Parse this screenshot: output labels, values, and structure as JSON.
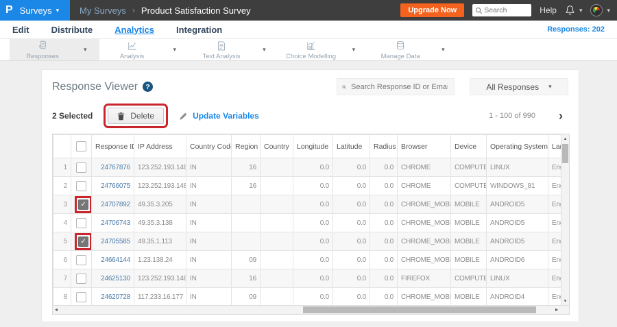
{
  "topbar": {
    "logo_letter": "P",
    "product_menu_label": "Surveys",
    "breadcrumb": {
      "parent": "My Surveys",
      "separator": "›",
      "current": "Product Satisfaction Survey"
    },
    "upgrade_button_label": "Upgrade Now",
    "search_placeholder": "Search",
    "help_label": "Help"
  },
  "nav": {
    "items": [
      {
        "label": "Edit",
        "active": false
      },
      {
        "label": "Distribute",
        "active": false
      },
      {
        "label": "Analytics",
        "active": true
      },
      {
        "label": "Integration",
        "active": false
      }
    ],
    "responses_count": "Responses: 202"
  },
  "toolbar": {
    "items": [
      {
        "label": "Responses",
        "icon": "responses-icon",
        "active": true
      },
      {
        "label": "Analysis",
        "icon": "analysis-icon",
        "active": false
      },
      {
        "label": "Text Analysis",
        "icon": "text-analysis-icon",
        "active": false
      },
      {
        "label": "Choice Modelling",
        "icon": "choice-modelling-icon",
        "active": false
      },
      {
        "label": "Manage Data",
        "icon": "manage-data-icon",
        "active": false
      }
    ]
  },
  "panel": {
    "title": "Response Viewer",
    "help_glyph": "?",
    "search_placeholder": "Search Response ID or Email",
    "filter_value": "All Responses",
    "selected_count_label": "2 Selected",
    "delete_button_label": "Delete",
    "update_variables_label": "Update Variables",
    "pagination_label": "1 - 100 of 990"
  },
  "table": {
    "sort": {
      "column": "Response ID",
      "direction": "asc"
    },
    "columns": [
      "",
      "",
      "Response ID",
      "IP Address",
      "Country Code",
      "Region",
      "Country",
      "Longitude",
      "Latitude",
      "Radius",
      "Browser",
      "Device",
      "Operating System",
      "Language"
    ],
    "rows": [
      {
        "num": "1",
        "checked": false,
        "annotated": false,
        "response_id": "24767876",
        "ip": "123.252.193.148",
        "country_code": "IN",
        "region": "16",
        "country": "",
        "longitude": "0.0",
        "latitude": "0.0",
        "radius": "0.0",
        "browser": "CHROME",
        "device": "COMPUTER",
        "os": "LINUX",
        "language": "English"
      },
      {
        "num": "2",
        "checked": false,
        "annotated": false,
        "response_id": "24766075",
        "ip": "123.252.193.148",
        "country_code": "IN",
        "region": "16",
        "country": "",
        "longitude": "0.0",
        "latitude": "0.0",
        "radius": "0.0",
        "browser": "CHROME",
        "device": "COMPUTER",
        "os": "WINDOWS_81",
        "language": "English"
      },
      {
        "num": "3",
        "checked": true,
        "annotated": true,
        "response_id": "24707892",
        "ip": "49.35.3.205",
        "country_code": "IN",
        "region": "",
        "country": "",
        "longitude": "0.0",
        "latitude": "0.0",
        "radius": "0.0",
        "browser": "CHROME_MOBILE",
        "device": "MOBILE",
        "os": "ANDROID5",
        "language": "English"
      },
      {
        "num": "4",
        "checked": false,
        "annotated": false,
        "response_id": "24706743",
        "ip": "49.35.3.138",
        "country_code": "IN",
        "region": "",
        "country": "",
        "longitude": "0.0",
        "latitude": "0.0",
        "radius": "0.0",
        "browser": "CHROME_MOBILE",
        "device": "MOBILE",
        "os": "ANDROID5",
        "language": "English"
      },
      {
        "num": "5",
        "checked": true,
        "annotated": true,
        "response_id": "24705585",
        "ip": "49.35.1.113",
        "country_code": "IN",
        "region": "",
        "country": "",
        "longitude": "0.0",
        "latitude": "0.0",
        "radius": "0.0",
        "browser": "CHROME_MOBILE",
        "device": "MOBILE",
        "os": "ANDROID5",
        "language": "English"
      },
      {
        "num": "6",
        "checked": false,
        "annotated": false,
        "response_id": "24664144",
        "ip": "1.23.138.24",
        "country_code": "IN",
        "region": "09",
        "country": "",
        "longitude": "0.0",
        "latitude": "0.0",
        "radius": "0.0",
        "browser": "CHROME_MOBILE",
        "device": "MOBILE",
        "os": "ANDROID6",
        "language": "English"
      },
      {
        "num": "7",
        "checked": false,
        "annotated": false,
        "response_id": "24625130",
        "ip": "123.252.193.148",
        "country_code": "IN",
        "region": "16",
        "country": "",
        "longitude": "0.0",
        "latitude": "0.0",
        "radius": "0.0",
        "browser": "FIREFOX",
        "device": "COMPUTER",
        "os": "LINUX",
        "language": "English"
      },
      {
        "num": "8",
        "checked": false,
        "annotated": false,
        "response_id": "24620728",
        "ip": "117.233.16.177",
        "country_code": "IN",
        "region": "09",
        "country": "",
        "longitude": "0.0",
        "latitude": "0.0",
        "radius": "0.0",
        "browser": "CHROME_MOBILE",
        "device": "MOBILE",
        "os": "ANDROID4",
        "language": "English"
      }
    ]
  },
  "colors": {
    "brand_blue": "#1b87e6",
    "topbar_dark": "#3e3e3e",
    "upgrade_orange": "#f4621d",
    "link_blue": "#4b7bab",
    "annotation_red": "#c9252d"
  }
}
